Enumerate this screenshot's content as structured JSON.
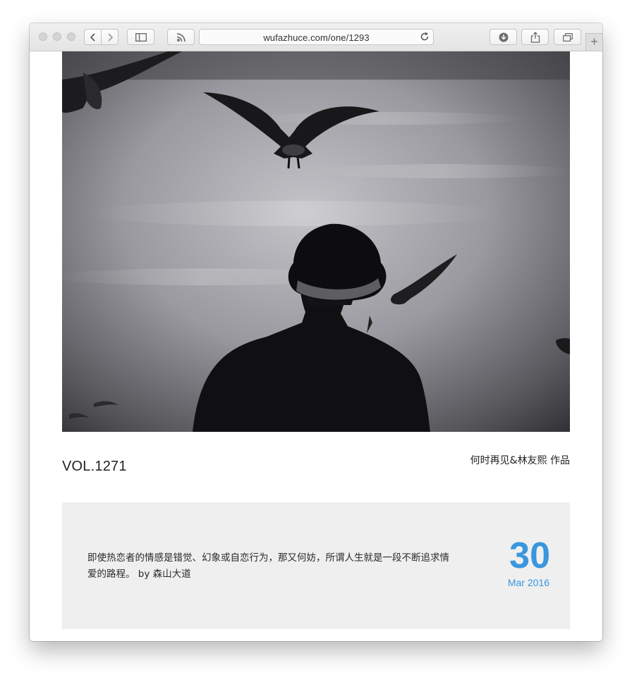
{
  "browser": {
    "url": "wufazhuce.com/one/1293",
    "new_tab_symbol": "+",
    "icons": {
      "back": "chevron-left-icon",
      "forward": "chevron-right-icon",
      "sidebar": "sidebar-icon",
      "reader": "rss-icon",
      "reload": "reload-icon",
      "downloads": "download-icon",
      "share": "share-icon",
      "tabs": "tabs-icon"
    }
  },
  "article": {
    "volume": "VOL.1271",
    "author": "何时再见&林友熙 作品",
    "photo_description_icon": "photo-bw-man-hat-seagulls",
    "quote": "即使热恋者的情感是错觉、幻象或自恋行为，那又何妨，所谓人生就是一段不断追求情爱的路程。 by 森山大道",
    "date_day": "30",
    "date_month_year": "Mar 2016"
  },
  "colors": {
    "accent": "#3a96dd",
    "quote_bg": "#efefef",
    "text": "#222222"
  }
}
